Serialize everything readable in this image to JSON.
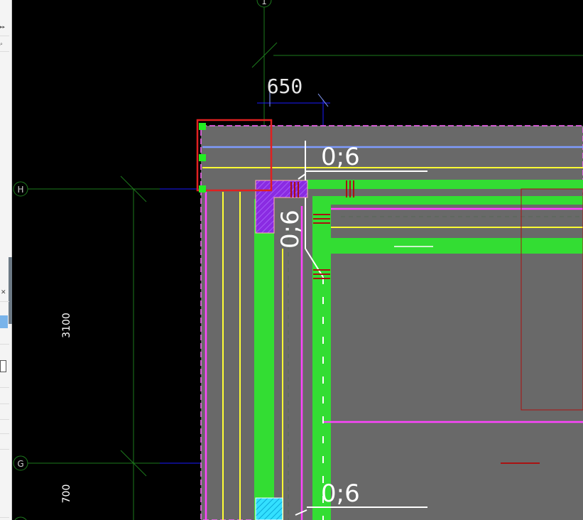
{
  "left_panel": {
    "top_button": "▸▸",
    "search_icon": "search-icon",
    "close_icon": "close-icon"
  },
  "drawing": {
    "grid_axes": [
      {
        "id": "axis-1",
        "label": "1"
      },
      {
        "id": "axis-h",
        "label": "H"
      },
      {
        "id": "axis-g",
        "label": "G"
      }
    ],
    "dimensions": {
      "top_width": "650",
      "span_h_g": "3100",
      "span_below_g": "700"
    },
    "annotations": {
      "top": "0;6",
      "side": "0;6",
      "bottom": "0;6"
    },
    "colors": {
      "background": "#000000",
      "slab": "#696969",
      "rebar_green": "#33dd33",
      "pink": "#ff44ff",
      "yellow": "#ffff33",
      "blue_line": "#7f9cff",
      "axis_blue": "#1a1aff",
      "grid_green": "#1d7a1d",
      "selection": "#e02020",
      "column_purple": "#8a2be2",
      "column_cyan": "#33e0ff",
      "dark_red": "#aa1111"
    }
  }
}
